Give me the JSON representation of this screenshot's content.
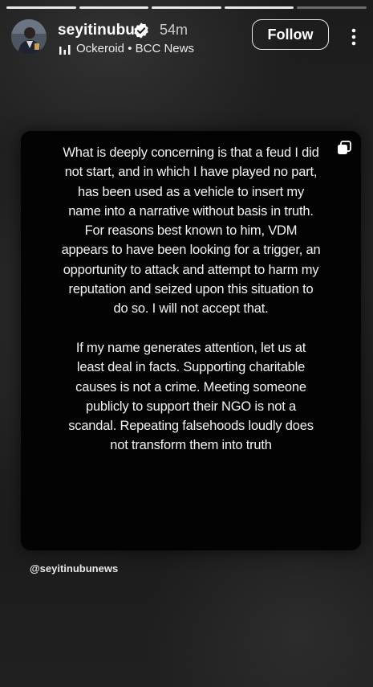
{
  "header": {
    "username": "seyitinubu",
    "time": "54m",
    "music_label": "Ockeroid • BCC News",
    "follow_label": "Follow",
    "avatar_icon": "profile-photo",
    "verified_icon": "verified-badge-icon",
    "music_icon": "audio-bars-icon",
    "more_icon": "vertical-ellipsis-icon"
  },
  "progress": {
    "segments": 5,
    "completed": 4
  },
  "card": {
    "paragraph_1": "What is deeply concerning is that a feud I did not start, and in which I have played no part, has been used as a vehicle to insert my name into a narrative without basis in truth. For reasons best known to him, VDM appears to have been looking for a trigger, an opportunity to attack and attempt to harm my reputation and seized upon this situation to do so. I will not accept that.",
    "paragraph_2": "If my name generates attention, let us at least deal in facts. Supporting charitable causes is not a crime. Meeting someone publicly to support their NGO is not a scandal. Repeating falsehoods loudly does not transform them into truth",
    "corner_icon": "carousel-icon"
  },
  "mention": "@seyitinubunews",
  "colors": {
    "background": "#141414",
    "card": "#030303",
    "text": "#ffffff"
  }
}
